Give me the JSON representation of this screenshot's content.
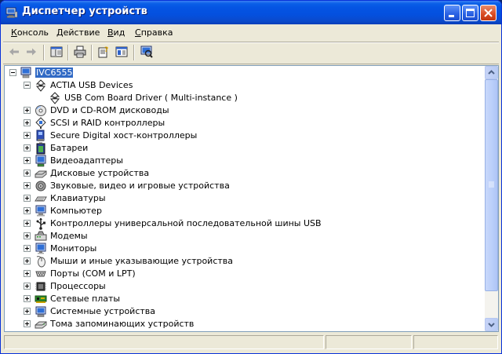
{
  "window": {
    "title": "Диспетчер устройств"
  },
  "menu": [
    {
      "label": "Консоль",
      "accel": "К",
      "rest": "онсоль"
    },
    {
      "label": "Действие",
      "accel": "Д",
      "rest": "ействие"
    },
    {
      "label": "Вид",
      "accel": "В",
      "rest": "ид"
    },
    {
      "label": "Справка",
      "accel": "С",
      "rest": "правка"
    }
  ],
  "toolbar": {
    "icons": [
      "back-arrow-icon",
      "forward-arrow-icon",
      "show-hide-tree-icon",
      "print-icon",
      "properties-icon",
      "help-icon",
      "scan-hardware-icon"
    ]
  },
  "tree": {
    "root": "IVC6555",
    "items": [
      {
        "label": "ACTIA USB Devices",
        "icon": "usb-device-icon",
        "expanded": true
      },
      {
        "label": "USB Com Board Driver ( Multi-instance )",
        "icon": "usb-device-icon",
        "child": true
      },
      {
        "label": "DVD и CD-ROM дисководы",
        "icon": "cdrom-icon"
      },
      {
        "label": "SCSI и RAID контроллеры",
        "icon": "scsi-icon"
      },
      {
        "label": "Secure Digital хост-контроллеры",
        "icon": "sd-host-icon"
      },
      {
        "label": "Батареи",
        "icon": "battery-icon"
      },
      {
        "label": "Видеоадаптеры",
        "icon": "display-adapter-icon"
      },
      {
        "label": "Дисковые устройства",
        "icon": "disk-drive-icon"
      },
      {
        "label": "Звуковые, видео и игровые устройства",
        "icon": "sound-icon"
      },
      {
        "label": "Клавиатуры",
        "icon": "keyboard-icon"
      },
      {
        "label": "Компьютер",
        "icon": "computer-icon"
      },
      {
        "label": "Контроллеры универсальной последовательной шины USB",
        "icon": "usb-controller-icon"
      },
      {
        "label": "Модемы",
        "icon": "modem-icon"
      },
      {
        "label": "Мониторы",
        "icon": "monitor-icon"
      },
      {
        "label": "Мыши и иные указывающие устройства",
        "icon": "mouse-icon"
      },
      {
        "label": "Порты (COM и LPT)",
        "icon": "port-icon"
      },
      {
        "label": "Процессоры",
        "icon": "processor-icon"
      },
      {
        "label": "Сетевые платы",
        "icon": "network-card-icon"
      },
      {
        "label": "Системные устройства",
        "icon": "system-device-icon"
      },
      {
        "label": "Тома запоминающих устройств",
        "icon": "storage-volume-icon"
      }
    ]
  },
  "colors": {
    "titlebar": "#0554e3",
    "selection": "#316ac5",
    "face": "#ece9d8"
  }
}
